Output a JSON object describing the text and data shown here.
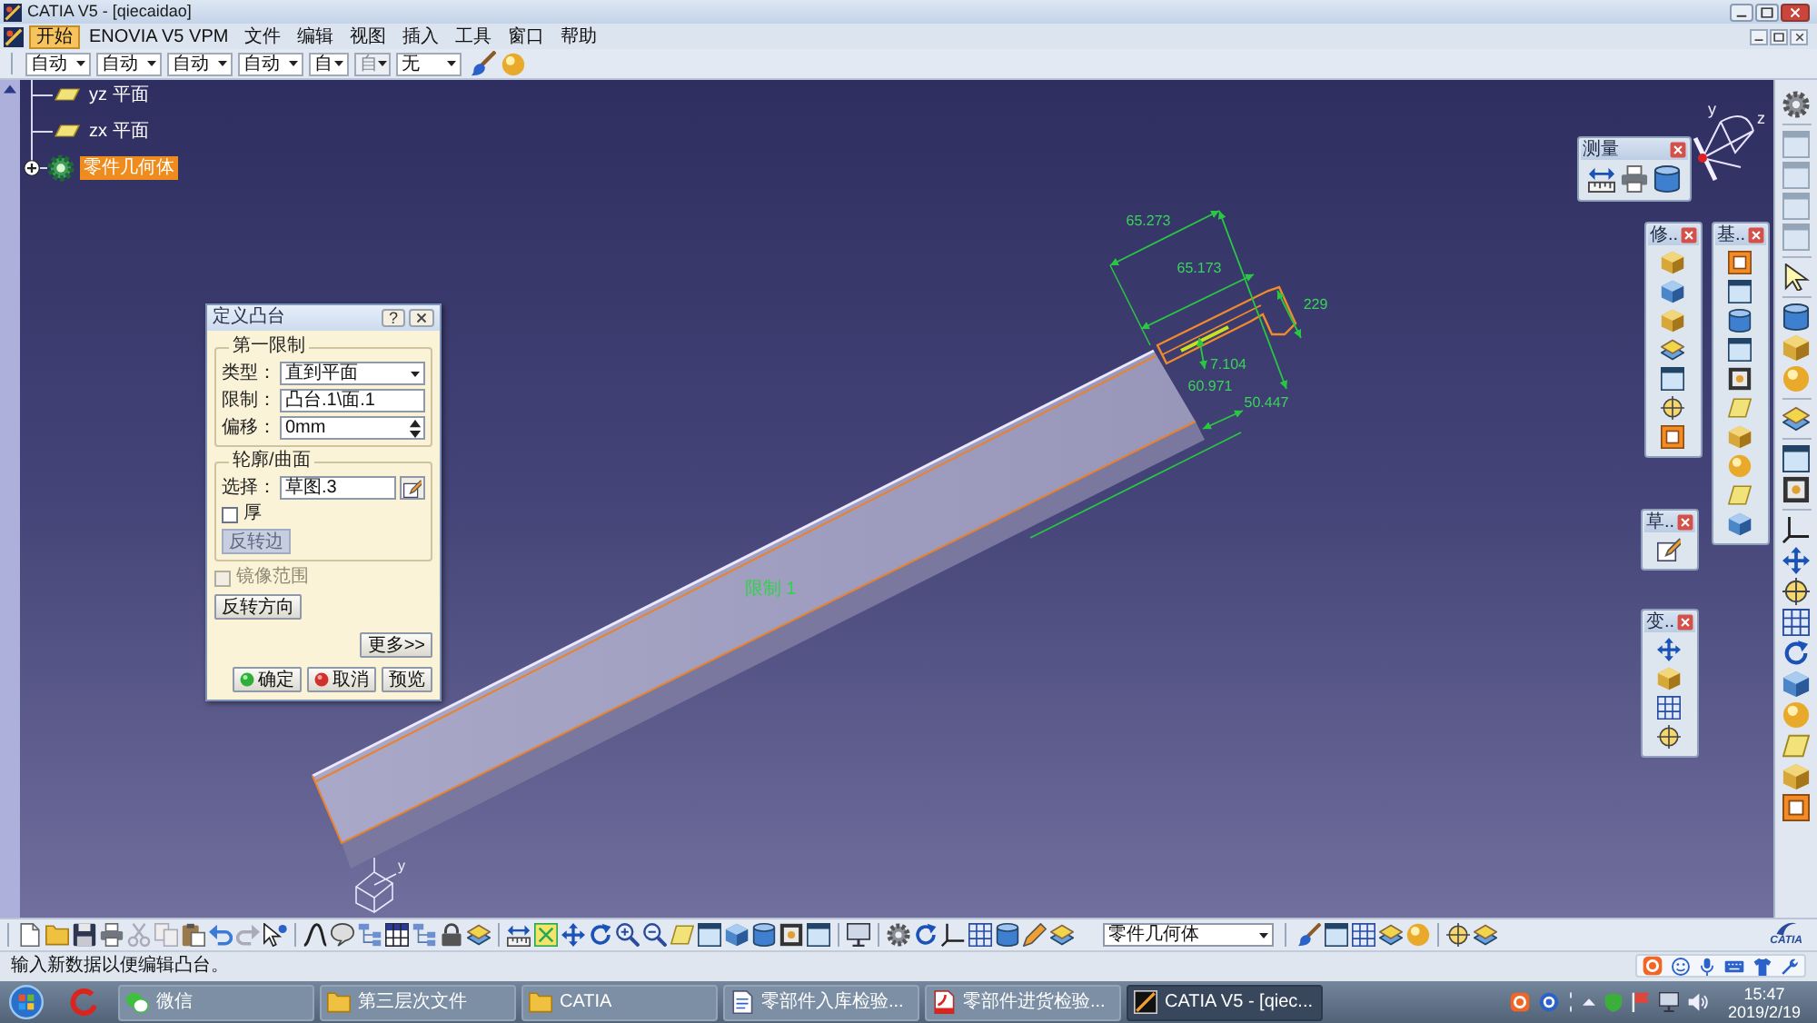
{
  "window": {
    "title": "CATIA V5 - [qiecaidao]"
  },
  "menu": [
    {
      "label": "开始",
      "selected": true
    },
    {
      "label": "ENOVIA V5 VPM",
      "selected": false
    },
    {
      "label": "文件",
      "selected": false
    },
    {
      "label": "编辑",
      "selected": false
    },
    {
      "label": "视图",
      "selected": false
    },
    {
      "label": "插入",
      "selected": false
    },
    {
      "label": "工具",
      "selected": false
    },
    {
      "label": "窗口",
      "selected": false
    },
    {
      "label": "帮助",
      "selected": false
    }
  ],
  "toolbar": {
    "dropdowns": [
      {
        "value": "自动",
        "disabled": false
      },
      {
        "value": "自动",
        "disabled": false
      },
      {
        "value": "自动",
        "disabled": false
      },
      {
        "value": "自动",
        "disabled": false
      },
      {
        "value": "自",
        "disabled": false
      },
      {
        "value": "自",
        "disabled": true
      },
      {
        "value": "无",
        "disabled": false
      }
    ]
  },
  "tree": [
    {
      "kind": "plane",
      "label": "yz 平面",
      "selected": false
    },
    {
      "kind": "plane",
      "label": "zx 平面",
      "selected": false
    },
    {
      "kind": "body",
      "label": "零件几何体",
      "selected": true,
      "expanded": false
    }
  ],
  "dialog": {
    "title": "定义凸台",
    "help": "?",
    "first_limit": {
      "title": "第一限制",
      "type": {
        "label": "类型：",
        "value": "直到平面"
      },
      "limit": {
        "label": "限制：",
        "value": "凸台.1\\面.1"
      },
      "offset": {
        "label": "偏移：",
        "value": "0mm"
      }
    },
    "profile": {
      "title": "轮廓/曲面",
      "selection": {
        "label": "选择：",
        "value": "草图.3"
      },
      "thick": {
        "label": "厚",
        "checked": false
      },
      "reverse_side": {
        "label": "反转边",
        "disabled": true
      }
    },
    "mirrored": {
      "label": "镜像范围",
      "checked": false,
      "disabled": true
    },
    "reverse_direction": "反转方向",
    "more": "更多>>",
    "buttons": [
      {
        "kind": "ok",
        "label": "确定"
      },
      {
        "kind": "cancel",
        "label": "取消"
      },
      {
        "kind": "preview",
        "label": "预览"
      }
    ]
  },
  "viewport": {
    "compass_labels": [
      "y",
      "z"
    ],
    "triad_labels": [
      "y"
    ],
    "annotations": [
      {
        "kind": "dimension",
        "text": "65.273"
      },
      {
        "kind": "dimension",
        "text": "65.173"
      },
      {
        "kind": "dimension",
        "text": "229"
      },
      {
        "kind": "dimension",
        "text": "7.104"
      },
      {
        "kind": "dimension",
        "text": "60.971"
      },
      {
        "kind": "dimension",
        "text": "50.447"
      },
      {
        "kind": "limit",
        "text": "限制 1"
      }
    ]
  },
  "floating_toolbars": [
    {
      "title": "测量"
    },
    {
      "title": "修.."
    },
    {
      "title": "基.."
    },
    {
      "title": "草.."
    },
    {
      "title": "变.."
    }
  ],
  "standard_toolbar": {
    "dropdown": "零件几何体",
    "logo": "CATIA"
  },
  "status_bar": {
    "message": "输入新数据以便编辑凸台。"
  },
  "taskbar": {
    "items": [
      {
        "kind": "chat",
        "label": "微信",
        "selected": false
      },
      {
        "kind": "folder",
        "label": "第三层次文件",
        "selected": false
      },
      {
        "kind": "folder",
        "label": "CATIA",
        "selected": false
      },
      {
        "kind": "document",
        "label": "零部件入库检验...",
        "selected": false
      },
      {
        "kind": "pdf",
        "label": "零部件进货检验...",
        "selected": false
      },
      {
        "kind": "window",
        "label": "CATIA V5 - [qiec...",
        "selected": true
      }
    ],
    "clock": {
      "time": "15:47",
      "date": "2019/2/19"
    }
  }
}
